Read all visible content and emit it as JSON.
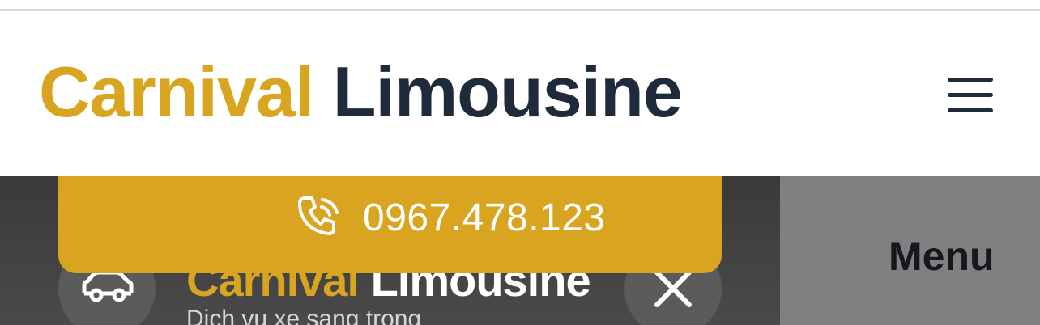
{
  "header": {
    "brand_primary": "Carnival",
    "brand_secondary": "Limousine"
  },
  "drawer": {
    "brand_primary": "Carnival",
    "brand_secondary": "Limousine",
    "tagline": "Dich vu xe sang trong",
    "phone": "0967.478.123"
  },
  "side_menu": {
    "label": "Menu"
  },
  "icons": {
    "menu": "hamburger-icon",
    "phone": "phone-icon",
    "car": "car-icon",
    "close": "close-icon"
  },
  "colors": {
    "brand_gold": "#d9a520",
    "brand_navy": "#1f2a3a",
    "panel_bg": "#3a3a3a",
    "menu_panel_bg": "#808080"
  }
}
